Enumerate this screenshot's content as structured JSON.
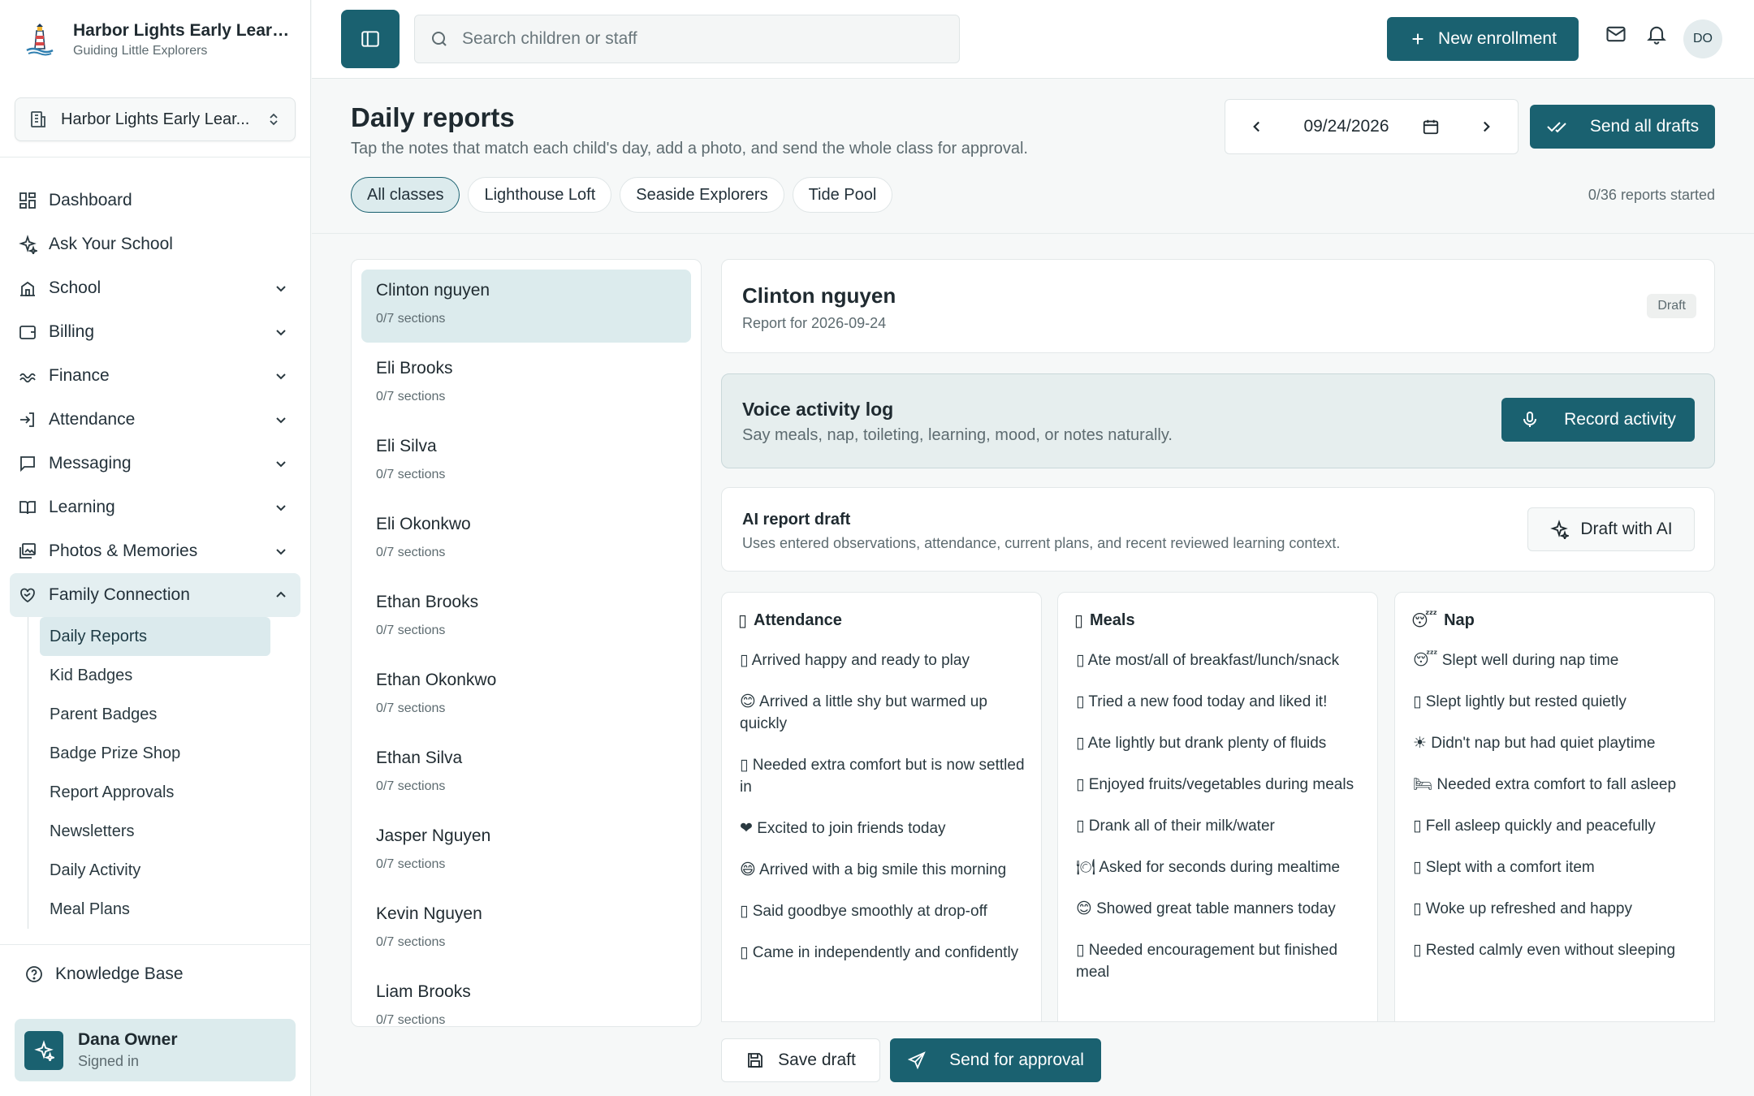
{
  "brand": {
    "name": "Harbor Lights Early Learn...",
    "tagline": "Guiding Little Explorers"
  },
  "school_select": {
    "value": "Harbor Lights Early Lear..."
  },
  "nav": {
    "items": [
      {
        "label": "Dashboard",
        "icon": "dashboard-icon"
      },
      {
        "label": "Ask Your School",
        "icon": "sparkles-icon"
      },
      {
        "label": "School",
        "icon": "school-icon"
      },
      {
        "label": "Billing",
        "icon": "wallet-icon"
      },
      {
        "label": "Finance",
        "icon": "finance-icon"
      },
      {
        "label": "Attendance",
        "icon": "sign-in-icon"
      },
      {
        "label": "Messaging",
        "icon": "message-icon"
      },
      {
        "label": "Learning",
        "icon": "book-icon"
      },
      {
        "label": "Photos & Memories",
        "icon": "images-icon"
      },
      {
        "label": "Family Connection",
        "icon": "heart-handshake-icon"
      }
    ],
    "sub_items": [
      "Daily Reports",
      "Kid Badges",
      "Parent Badges",
      "Badge Prize Shop",
      "Report Approvals",
      "Newsletters",
      "Daily Activity",
      "Meal Plans"
    ]
  },
  "kb_link": "Knowledge Base",
  "user": {
    "name": "Dana Owner",
    "status": "Signed in"
  },
  "topbar": {
    "search_placeholder": "Search children or staff",
    "new_enrollment": "New enrollment",
    "avatar_initials": "DO"
  },
  "page": {
    "title": "Daily reports",
    "subtitle": "Tap the notes that match each child's day, add a photo, and send the whole class for approval.",
    "date": "09/24/2026",
    "send_all": "Send all drafts",
    "class_tabs": [
      "All classes",
      "Lighthouse Loft",
      "Seaside Explorers",
      "Tide Pool"
    ],
    "reports_started": "0/36 reports started"
  },
  "children": [
    {
      "name": "Clinton nguyen",
      "meta": "0/7 sections"
    },
    {
      "name": "Eli Brooks",
      "meta": "0/7 sections"
    },
    {
      "name": "Eli Silva",
      "meta": "0/7 sections"
    },
    {
      "name": "Eli Okonkwo",
      "meta": "0/7 sections"
    },
    {
      "name": "Ethan Brooks",
      "meta": "0/7 sections"
    },
    {
      "name": "Ethan Okonkwo",
      "meta": "0/7 sections"
    },
    {
      "name": "Ethan Silva",
      "meta": "0/7 sections"
    },
    {
      "name": "Jasper Nguyen",
      "meta": "0/7 sections"
    },
    {
      "name": "Kevin Nguyen",
      "meta": "0/7 sections"
    },
    {
      "name": "Liam Brooks",
      "meta": "0/7 sections"
    }
  ],
  "report": {
    "child_name": "Clinton nguyen",
    "report_for": "Report for 2026-09-24",
    "status": "Draft",
    "voice": {
      "title": "Voice activity log",
      "subtitle": "Say meals, nap, toileting, learning, mood, or notes naturally.",
      "button": "Record activity"
    },
    "ai": {
      "title": "AI report draft",
      "subtitle": "Uses entered observations, attendance, current plans, and recent reviewed learning context.",
      "button": "Draft with AI"
    }
  },
  "sections": [
    {
      "title": "Attendance",
      "icon": "▯",
      "options": [
        "▯ Arrived happy and ready to play",
        "😊 Arrived a little shy but warmed up quickly",
        "▯ Needed extra comfort but is now settled in",
        "❤ Excited to join friends today",
        "😄 Arrived with a big smile this morning",
        "▯ Said goodbye smoothly at drop-off",
        "▯ Came in independently and confidently"
      ]
    },
    {
      "title": "Meals",
      "icon": "▯",
      "options": [
        "▯ Ate most/all of breakfast/lunch/snack",
        "▯ Tried a new food today and liked it!",
        "▯ Ate lightly but drank plenty of fluids",
        "▯ Enjoyed fruits/vegetables during meals",
        "▯ Drank all of their milk/water",
        "🍽 Asked for seconds during mealtime",
        "😊 Showed great table manners today",
        "▯ Needed encouragement but finished meal"
      ]
    },
    {
      "title": "Nap",
      "icon": "😴",
      "options": [
        "😴 Slept well during nap time",
        "▯ Slept lightly but rested quietly",
        "☀ Didn't nap but had quiet playtime",
        "🛏 Needed extra comfort to fall asleep",
        "▯ Fell asleep quickly and peacefully",
        "▯ Slept with a comfort item",
        "▯ Woke up refreshed and happy",
        "▯ Rested calmly even without sleeping"
      ]
    }
  ],
  "footer": {
    "save_draft": "Save draft",
    "send_for_approval": "Send for approval"
  },
  "colors": {
    "accent": "#1a6170",
    "accent_light": "#dcebed",
    "background": "#f6f8f8"
  }
}
